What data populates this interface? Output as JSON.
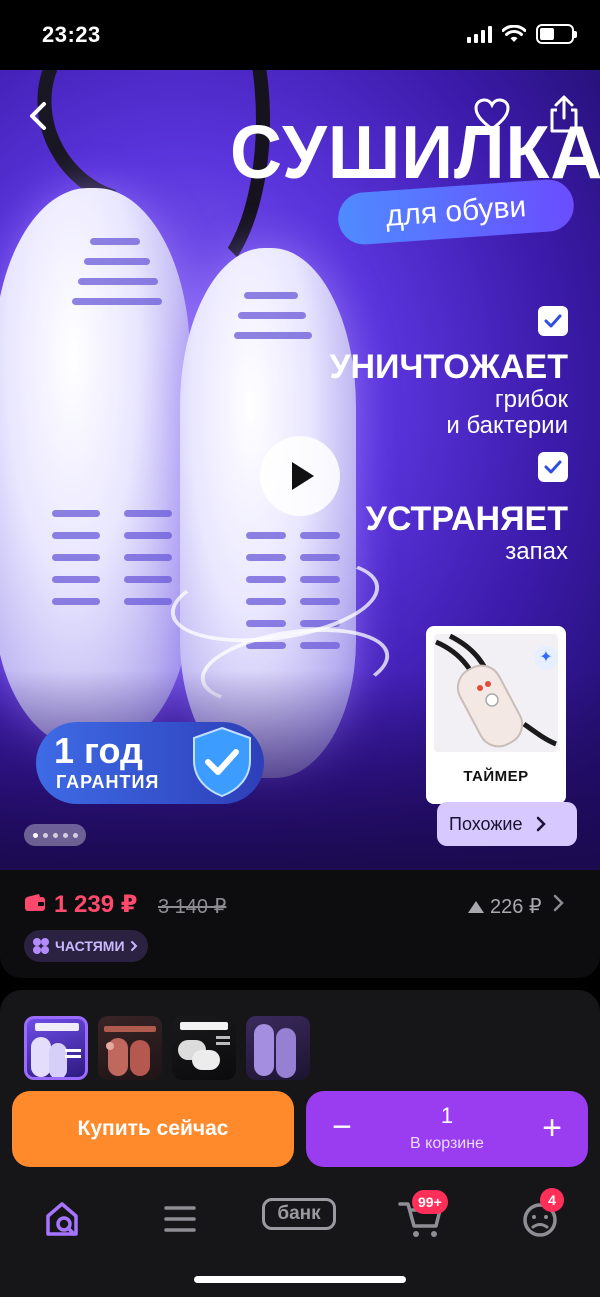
{
  "status": {
    "time": "23:23"
  },
  "hero": {
    "title": "СУШИЛКА",
    "subtitle": "для обуви",
    "features": [
      {
        "title": "УНИЧТОЖАЕТ",
        "sub_line1": "грибок",
        "sub_line2": "и бактерии"
      },
      {
        "title": "УСТРАНЯЕТ",
        "sub_line1": "запах",
        "sub_line2": ""
      }
    ],
    "warranty_year": "1 год",
    "warranty_label": "ГАРАНТИЯ",
    "image_count": 5,
    "active_image": 1,
    "timer_label": "ТАЙМЕР",
    "similar_label": "Похожие",
    "icons": [
      "back-arrow-icon",
      "heart-icon",
      "share-icon",
      "play-icon",
      "shield-check-icon",
      "sparkle-icon"
    ]
  },
  "price": {
    "current": "1 239 ₽",
    "old": "3 140 ₽",
    "delta": "226 ₽",
    "installments_label": "ЧАСТЯМИ",
    "current_color": "#ff4a6e"
  },
  "actions": {
    "buy_now": "Купить сейчас",
    "cart_quantity": "1",
    "cart_label": "В корзине",
    "minus": "−",
    "plus": "+",
    "buy_color": "#ff8a2b",
    "cart_color": "#9a3cf0"
  },
  "tabbar": {
    "items": [
      "home-search-icon",
      "menu-icon",
      "bank-logo",
      "cart-icon",
      "profile-icon"
    ],
    "bank_label": "банк",
    "cart_badge": "99+",
    "profile_badge": "4"
  }
}
